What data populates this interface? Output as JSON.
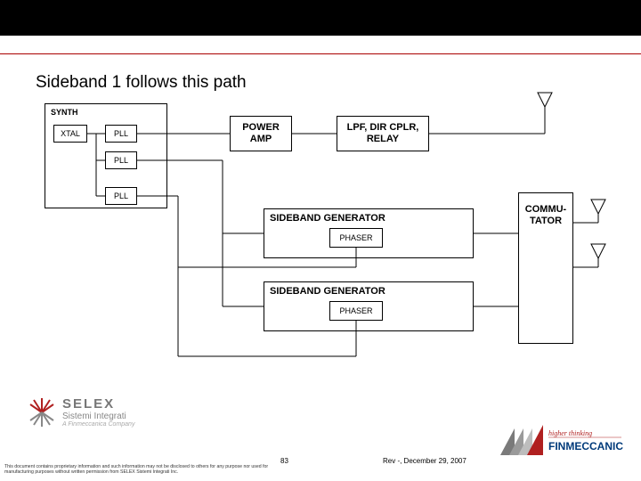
{
  "title": "Sideband 1 follows this path",
  "blocks": {
    "synth": "SYNTH",
    "xtal": "XTAL",
    "pll": "PLL",
    "power_amp": "POWER\nAMP",
    "lpf": "LPF, DIR CPLR,\nRELAY",
    "sbg": "SIDEBAND GENERATOR",
    "phaser": "PHASER",
    "commutator": "COMMU-\nTATOR"
  },
  "footer": {
    "brand": "SELEX",
    "brand_sub": "Sistemi Integrati",
    "brand_tag": "A Finmeccanica Company",
    "disclaimer": "This document contains proprietary information and such information may not be disclosed to others for any purpose nor used for manufacturing purposes without written permission from SELEX Sistemi Integrati Inc.",
    "page": "83",
    "rev": "Rev -, December 29, 2007",
    "rbrand1": "higher thinking",
    "rbrand2": "FINMECCANICA"
  }
}
